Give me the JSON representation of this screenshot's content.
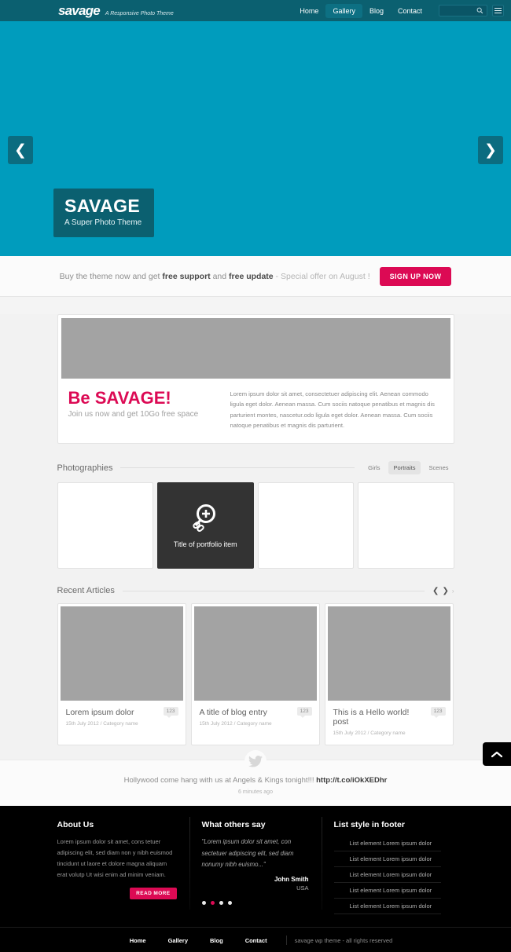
{
  "header": {
    "logo": "savage",
    "tagline": "A Responsive Photo Theme",
    "nav": [
      {
        "label": "Home",
        "active": false
      },
      {
        "label": "Gallery",
        "active": true
      },
      {
        "label": "Blog",
        "active": false
      },
      {
        "label": "Contact",
        "active": false
      }
    ],
    "search_placeholder": "",
    "search_value": "",
    "search_icon": "search-icon",
    "menu_icon": "hamburger-menu-icon"
  },
  "slider": {
    "prev_icon": "chevron-left-icon",
    "next_icon": "chevron-right-icon",
    "caption_title": "SAVAGE",
    "caption_sub": "A Super Photo Theme",
    "bg_color": "#009cbd"
  },
  "promo_bar": {
    "text_1": "Buy the theme now and get ",
    "bold_1": "free support",
    "text_2": " and ",
    "bold_2": "free update",
    "text_3": "  -  Special offer on August !",
    "button": "SIGN UP NOW",
    "button_color": "#dc0a54"
  },
  "promo_card": {
    "heading_light": "Be ",
    "heading_bold": "SAVAGE!",
    "subheading": "Join us now and get 10Go free space",
    "paragraph": "Lorem ipsum dolor sit amet, consectetuer adipiscing elit. Aenean commodo ligula eget dolor. Aenean massa. Cum sociis natoque penatibus et magnis dis parturient montes, nascetur.odo ligula eget dolor. Aenean massa. Cum sociis natoque penatibus et magnis dis parturient."
  },
  "portfolio": {
    "title": "Photographies",
    "filters": [
      {
        "label": "Girls",
        "active": false
      },
      {
        "label": "Portraits",
        "active": true
      },
      {
        "label": "Scenes",
        "active": false
      }
    ],
    "items": [
      {
        "title": ""
      },
      {
        "title": "Title of portfolio item",
        "hover": true
      },
      {
        "title": ""
      },
      {
        "title": ""
      }
    ],
    "zoom_icon": "magnifier-plus-icon",
    "link_icon": "chain-link-icon"
  },
  "articles": {
    "title": "Recent Articles",
    "prev_icon": "chevron-left-icon",
    "next_icon": "chevron-right-icon",
    "extra_icon": "chevron-right-small-icon",
    "cards": [
      {
        "title": "Lorem ipsum dolor",
        "meta": "15th July 2012 / Category name",
        "comments": "123"
      },
      {
        "title": "A title of blog entry",
        "meta": "15th July 2012 / Category name",
        "comments": "123"
      },
      {
        "title": "This is a Hello world! post",
        "meta": "15th July 2012 / Category name",
        "comments": "123"
      }
    ]
  },
  "twitter": {
    "icon": "twitter-bird-icon",
    "text": "Hollywood come hang with us at Angels & Kings tonight!!! ",
    "link": "http://t.co/iOkXEDhr",
    "time": "6 minutes ago"
  },
  "scroll_top": {
    "icon": "chevron-up-icon"
  },
  "footer": {
    "about": {
      "title": "About Us",
      "paragraph": "Lorem ipsum dolor sit amet, cons tetuer adipiscing elit, sed diam non y nibh euismod tincidunt ut laore et dolore magna aliquam erat volutp Ut wisi enim ad minim veniam.",
      "button": "READ MORE"
    },
    "testimonial": {
      "title": "What others say",
      "quote": "\"Lorem ipsum dolor sit amet, con sectetuer adipiscing elit, sed diam nonumy nibh euismo...\"",
      "author": "John Smith",
      "location": "USA",
      "dots": [
        false,
        true,
        false,
        false
      ]
    },
    "list": {
      "title": "List style in footer",
      "items": [
        "List element Lorem ipsum dolor",
        "List element Lorem ipsum dolor",
        "List element Lorem ipsum dolor",
        "List element Lorem ipsum dolor",
        "List element Lorem ipsum dolor"
      ]
    },
    "bottom_nav": [
      "Home",
      "Gallery",
      "Blog",
      "Contact"
    ],
    "copyright": "savage wp theme - all rights reserved"
  }
}
